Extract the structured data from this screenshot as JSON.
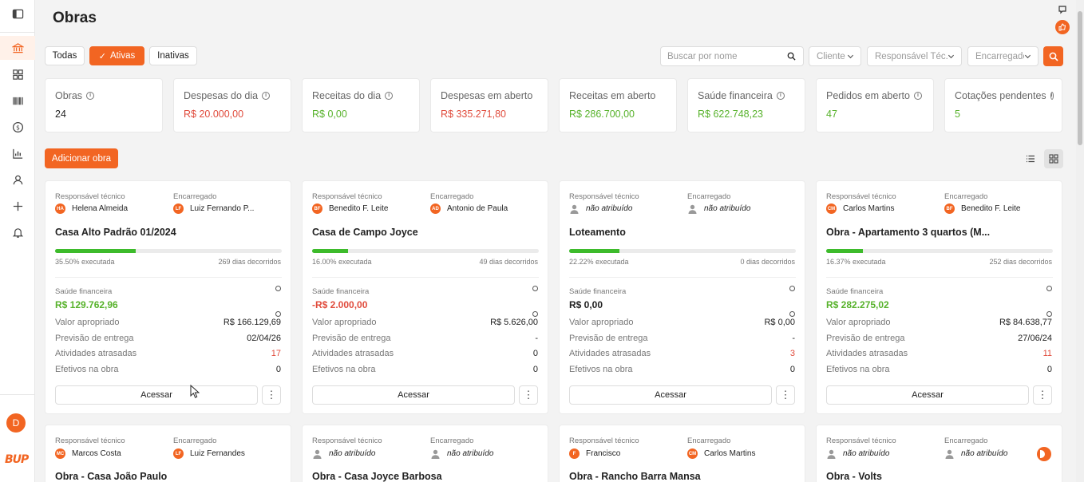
{
  "page": {
    "title": "Obras"
  },
  "colors": {
    "accent": "#f26522",
    "negative": "#e04b3c",
    "positive": "#57b22b",
    "progress": "#3dbb2b"
  },
  "sidebar": {
    "items": [
      {
        "icon": "sidebar-toggle-icon"
      },
      {
        "icon": "bank-icon",
        "active": true
      },
      {
        "icon": "grid-icon"
      },
      {
        "icon": "barcode-icon"
      },
      {
        "icon": "dollar-icon"
      },
      {
        "icon": "bar-chart-icon"
      },
      {
        "icon": "user-icon"
      },
      {
        "icon": "plus-icon"
      },
      {
        "icon": "bell-icon"
      }
    ],
    "avatar_initial": "D",
    "logo": "BUP"
  },
  "filters": {
    "status_tabs": [
      "Todas",
      "Ativas",
      "Inativas"
    ],
    "active_tab": "Ativas",
    "search_placeholder": "Buscar por nome",
    "selects": [
      "Cliente",
      "Responsável Téc.",
      "Encarregado"
    ]
  },
  "stats": [
    {
      "label": "Obras",
      "value": "24",
      "tone": "dark",
      "info": true
    },
    {
      "label": "Despesas do dia",
      "value": "R$ 20.000,00",
      "tone": "red",
      "info": true
    },
    {
      "label": "Receitas do dia",
      "value": "R$ 0,00",
      "tone": "green",
      "info": true
    },
    {
      "label": "Despesas em aberto",
      "value": "R$ 335.271,80",
      "tone": "red",
      "info": false
    },
    {
      "label": "Receitas em aberto",
      "value": "R$ 286.700,00",
      "tone": "green",
      "info": false
    },
    {
      "label": "Saúde financeira",
      "value": "R$ 622.748,23",
      "tone": "green",
      "info": true
    },
    {
      "label": "Pedidos em aberto",
      "value": "47",
      "tone": "green",
      "info": true
    },
    {
      "label": "Cotações pendentes",
      "value": "5",
      "tone": "green",
      "info": true
    }
  ],
  "actions": {
    "add_label": "Adicionar obra"
  },
  "card_labels": {
    "resp_tecnico": "Responsável técnico",
    "encarregado": "Encarregado",
    "saude": "Saúde financeira",
    "valor_apropriado": "Valor apropriado",
    "previsao": "Previsão de entrega",
    "atividades": "Atividades atrasadas",
    "efetivos": "Efetivos na obra",
    "acessar": "Acessar",
    "more": "⋮"
  },
  "cards": [
    {
      "resp": {
        "initials": "HA",
        "name": "Helena Almeida"
      },
      "enc": {
        "initials": "LF",
        "name": "Luiz Fernando P..."
      },
      "title": "Casa Alto Padrão 01/2024",
      "progress": 0.355,
      "executed": "35.50% executada",
      "days": "269 dias decorridos",
      "saude": "R$ 129.762,96",
      "saude_tone": "green",
      "valor": "R$ 166.129,69",
      "previsao": "02/04/26",
      "atividades": "17",
      "atividades_red": true,
      "efetivos": "0"
    },
    {
      "resp": {
        "initials": "BF",
        "name": "Benedito F. Leite"
      },
      "enc": {
        "initials": "AD",
        "name": "Antonio de Paula"
      },
      "title": "Casa de Campo Joyce",
      "progress": 0.16,
      "executed": "16.00% executada",
      "days": "49 dias decorridos",
      "saude": "-R$ 2.000,00",
      "saude_tone": "red",
      "valor": "R$ 5.626,00",
      "previsao": "-",
      "atividades": "0",
      "atividades_red": false,
      "efetivos": "0"
    },
    {
      "resp": {
        "initials": "",
        "name": "não atribuído",
        "unassigned": true
      },
      "enc": {
        "initials": "",
        "name": "não atribuído",
        "unassigned": true
      },
      "title": "Loteamento",
      "progress": 0.2222,
      "executed": "22.22% executada",
      "days": "0 dias decorridos",
      "saude": "R$ 0,00",
      "saude_tone": "dark",
      "valor": "R$ 0,00",
      "previsao": "-",
      "atividades": "3",
      "atividades_red": true,
      "efetivos": "0"
    },
    {
      "resp": {
        "initials": "CM",
        "name": "Carlos Martins"
      },
      "enc": {
        "initials": "BF",
        "name": "Benedito F. Leite"
      },
      "title": "Obra - Apartamento 3 quartos (M...",
      "progress": 0.1637,
      "executed": "16.37% executada",
      "days": "252 dias decorridos",
      "saude": "R$ 282.275,02",
      "saude_tone": "green",
      "valor": "R$ 84.638,77",
      "previsao": "27/06/24",
      "atividades": "11",
      "atividades_red": true,
      "efetivos": "0"
    }
  ],
  "cards_row2": [
    {
      "resp": {
        "initials": "MC",
        "name": "Marcos Costa"
      },
      "enc": {
        "initials": "LF",
        "name": "Luiz Fernandes"
      },
      "title": "Obra - Casa João Paulo"
    },
    {
      "resp": {
        "initials": "",
        "name": "não atribuído",
        "unassigned": true
      },
      "enc": {
        "initials": "",
        "name": "não atribuído",
        "unassigned": true
      },
      "title": "Obra - Casa Joyce Barbosa"
    },
    {
      "resp": {
        "initials": "F",
        "name": "Francisco"
      },
      "enc": {
        "initials": "CM",
        "name": "Carlos Martins"
      },
      "title": "Obra - Rancho Barra Mansa"
    },
    {
      "resp": {
        "initials": "",
        "name": "não atribuído",
        "unassigned": true
      },
      "enc": {
        "initials": "",
        "name": "não atribuído",
        "unassigned": true
      },
      "title": "Obra - Volts"
    }
  ]
}
